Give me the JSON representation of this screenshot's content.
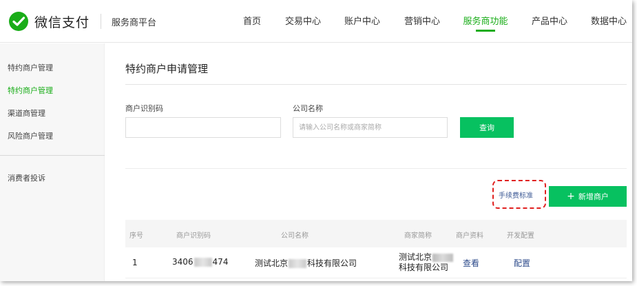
{
  "header": {
    "logo_text": "微信支付",
    "platform": "服务商平台",
    "nav": [
      {
        "label": "首页"
      },
      {
        "label": "交易中心"
      },
      {
        "label": "账户中心"
      },
      {
        "label": "营销中心"
      },
      {
        "label": "服务商功能",
        "active": true
      },
      {
        "label": "产品中心"
      },
      {
        "label": "数据中心"
      }
    ]
  },
  "sidebar": {
    "items": [
      {
        "label": "特约商户管理"
      },
      {
        "label": "特约商户管理",
        "active": true
      },
      {
        "label": "渠道商管理"
      },
      {
        "label": "风险商户管理"
      },
      {
        "label": "消费者投诉"
      }
    ]
  },
  "main": {
    "title": "特约商户申请管理",
    "filters": {
      "merchant_id_label": "商户识别码",
      "merchant_id_value": "",
      "company_label": "公司名称",
      "company_placeholder": "请输入公司名称或商家简称",
      "query_label": "查询"
    },
    "actions": {
      "fee_link": "手续费标准",
      "add_merchant": "新增商户"
    },
    "table": {
      "headers": [
        "序号",
        "商户识别码",
        "公司名称",
        "商家简称",
        "商户资料",
        "开发配置"
      ],
      "rows": [
        {
          "index": "1",
          "merchant_id_prefix": "3406",
          "merchant_id_suffix": "474",
          "company_prefix": "测试北京",
          "company_suffix": "科技有限公司",
          "short_name_line1": "测试北京",
          "short_name_line2": "科技有限公司",
          "profile_link": "查看",
          "config_link": "配置"
        }
      ]
    }
  },
  "colors": {
    "brand_green": "#07c160",
    "nav_active": "#1aad19",
    "link_blue": "#2c4a8a",
    "highlight_red": "#e0201f"
  },
  "icons": [
    "wechat-pay-logo-icon",
    "plus-icon"
  ]
}
